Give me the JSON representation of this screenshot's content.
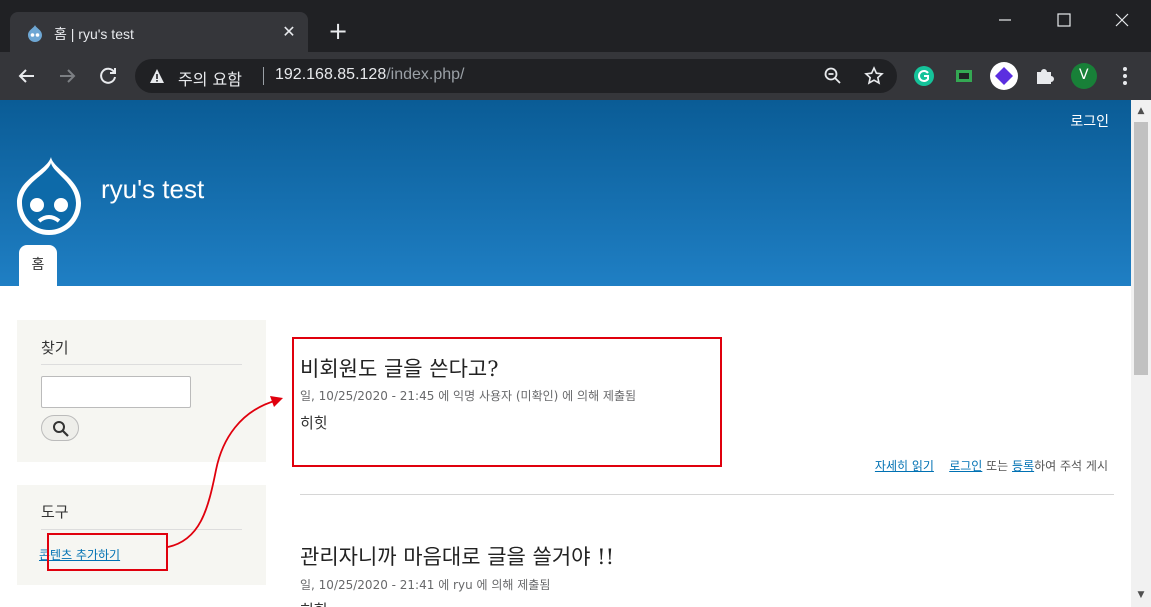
{
  "browser": {
    "tab_title": "홈 | ryu's test",
    "new_tab": "+",
    "security_label": "주의 요함",
    "url_host": "192.168.85.128",
    "url_path": "/index.php/",
    "profile_initial": "V"
  },
  "site": {
    "login_label": "로그인",
    "name": "ryu's test",
    "home_tab": "홈"
  },
  "sidebar": {
    "search_title": "찾기",
    "tools_title": "도구",
    "add_content_label": "콘텐츠 추가하기"
  },
  "articles": [
    {
      "title": "비회원도 글을 쓴다고?",
      "meta": "일, 10/25/2020 - 21:45 에 익명 사용자 (미확인) 에 의해 제출됨",
      "body": "히힛",
      "read_more": "자세히 읽기",
      "login": "로그인",
      "or": " 또는 ",
      "register": "등록",
      "comment_suffix": "하여 주석 게시"
    },
    {
      "title": "관리자니까 마음대로 글을 쓸거야 !!",
      "meta": "일, 10/25/2020 - 21:41 에 ryu 에 의해 제출됨",
      "body": "히힛"
    }
  ],
  "colors": {
    "header_top": "#0a5c96",
    "header_bottom": "#1f7fc4",
    "annotation_red": "#e0000d",
    "link": "#0071b3"
  }
}
